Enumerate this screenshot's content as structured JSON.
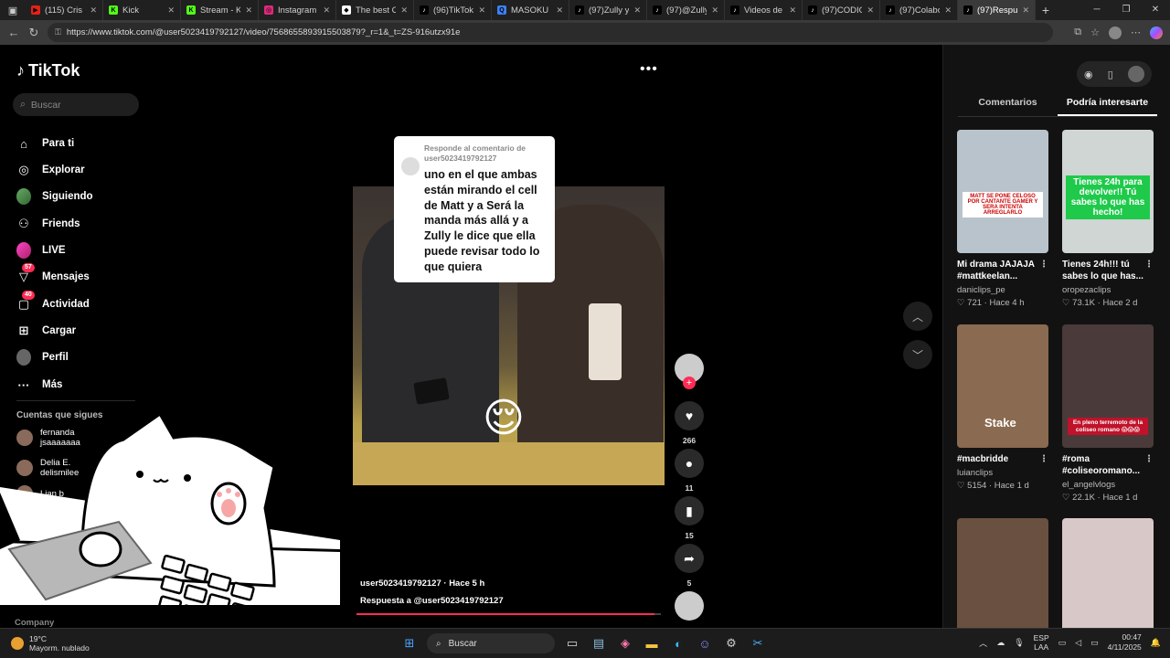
{
  "browser": {
    "tabs": [
      {
        "title": "(115) Cris M",
        "color": "#e62117",
        "glyph": "▶"
      },
      {
        "title": "Kick",
        "color": "#53fc18",
        "glyph": "K"
      },
      {
        "title": "Stream - Kick",
        "color": "#53fc18",
        "glyph": "K"
      },
      {
        "title": "Instagram",
        "color": "#dd2a7b",
        "glyph": "◎"
      },
      {
        "title": "The best Ch",
        "color": "#ffffff",
        "glyph": "◆"
      },
      {
        "title": "(96)TikTok -",
        "color": "#000000",
        "glyph": "♪"
      },
      {
        "title": "MASOKU ED",
        "color": "#3b82f6",
        "glyph": "Q"
      },
      {
        "title": "(97)Zully y M",
        "color": "#000000",
        "glyph": "♪"
      },
      {
        "title": "(97)@Zully",
        "color": "#000000",
        "glyph": "♪"
      },
      {
        "title": "Videos de Ti",
        "color": "#000000",
        "glyph": "♪"
      },
      {
        "title": "(97)CODIGO",
        "color": "#000000",
        "glyph": "♪"
      },
      {
        "title": "(97)Colabora",
        "color": "#000000",
        "glyph": "♪"
      },
      {
        "title": "(97)Respue",
        "color": "#000000",
        "glyph": "♪",
        "active": true
      }
    ],
    "url": "https://www.tiktok.com/@user5023419792127/video/7568655893915503879?_r=1&_t=ZS-916utzx91e"
  },
  "sidebar": {
    "logo": "TikTok",
    "search_placeholder": "Buscar",
    "nav": [
      {
        "label": "Para ti",
        "icon": "home-icon",
        "glyph": "⌂"
      },
      {
        "label": "Explorar",
        "icon": "compass-icon",
        "glyph": "◎"
      },
      {
        "label": "Siguiendo",
        "icon": "following-avatar-icon",
        "glyph": ""
      },
      {
        "label": "Friends",
        "icon": "friends-icon",
        "glyph": "⚇"
      },
      {
        "label": "LIVE",
        "icon": "live-icon",
        "glyph": ""
      },
      {
        "label": "Mensajes",
        "icon": "messages-icon",
        "glyph": "▽",
        "badge": "57"
      },
      {
        "label": "Actividad",
        "icon": "activity-icon",
        "glyph": "▢",
        "badge": "40"
      },
      {
        "label": "Cargar",
        "icon": "upload-icon",
        "glyph": "⊞"
      },
      {
        "label": "Perfil",
        "icon": "profile-icon",
        "glyph": ""
      },
      {
        "label": "Más",
        "icon": "more-icon",
        "glyph": "···"
      }
    ],
    "following_title": "Cuentas que sigues",
    "following": [
      {
        "name": "fernanda",
        "handle": "jsaaaaaaa"
      },
      {
        "name": "Delia E.",
        "handle": "delismilee"
      },
      {
        "name": "Lian b",
        "handle": ""
      }
    ],
    "company": "Company"
  },
  "video": {
    "comment_reply_header": "Responde al comentario de user5023419792127",
    "comment_text": "uno en el que ambas están mirando el cell de Matt y a Será la manda más allá y a Zully le dice que ella puede revisar todo lo que quiera",
    "author_line": "user5023419792127 · Hace 5 h",
    "reply_line": "Respuesta a @user5023419792127",
    "progress": 0.98,
    "emoji": "😌"
  },
  "actions": {
    "likes": "266",
    "comments": "11",
    "saves": "15",
    "shares": "5"
  },
  "right_panel": {
    "tabs": [
      "Comentarios",
      "Podría interesarte"
    ],
    "cards": [
      {
        "title": "Mi drama JAJAJA #mattkeelan...",
        "author": "daniclips_pe",
        "likes": "721",
        "time": "Hace 4 h",
        "overlay": "MATT SE PONE CELOSO POR CANTANTE GAMER Y SERA INTENTA ARREGLARLO",
        "bg": "#b9c3cc"
      },
      {
        "title": "Tienes 24h!!! tú sabes lo que has...",
        "author": "oropezaclips",
        "likes": "73.1K",
        "time": "Hace 2 d",
        "overlay": "Tienes 24h para devolver!! Tú sabes lo que has hecho!",
        "bg": "#cfd6d4"
      },
      {
        "title": "#macbridde",
        "author": "luianclips",
        "likes": "5154",
        "time": "Hace 1 d",
        "overlay": "Stake",
        "bg": "#8a6a50"
      },
      {
        "title": "#roma #coliseoromano...",
        "author": "el_angelvlogs",
        "likes": "22.1K",
        "time": "Hace 1 d",
        "overlay": "En pleno terremoto de la coliseo romano 😱😱😱",
        "bg": "#4a3a3a"
      },
      {
        "title": "",
        "author": "",
        "likes": "",
        "time": "",
        "overlay": "",
        "bg": "#6a5040"
      },
      {
        "title": "",
        "author": "",
        "likes": "",
        "time": "",
        "overlay": "",
        "bg": "#d8c8c8"
      }
    ]
  },
  "taskbar": {
    "temp": "19°C",
    "weather": "Mayorm. nublado",
    "search": "Buscar",
    "lang1": "ESP",
    "lang2": "LAA",
    "time": "00:47",
    "date": "4/11/2025"
  }
}
